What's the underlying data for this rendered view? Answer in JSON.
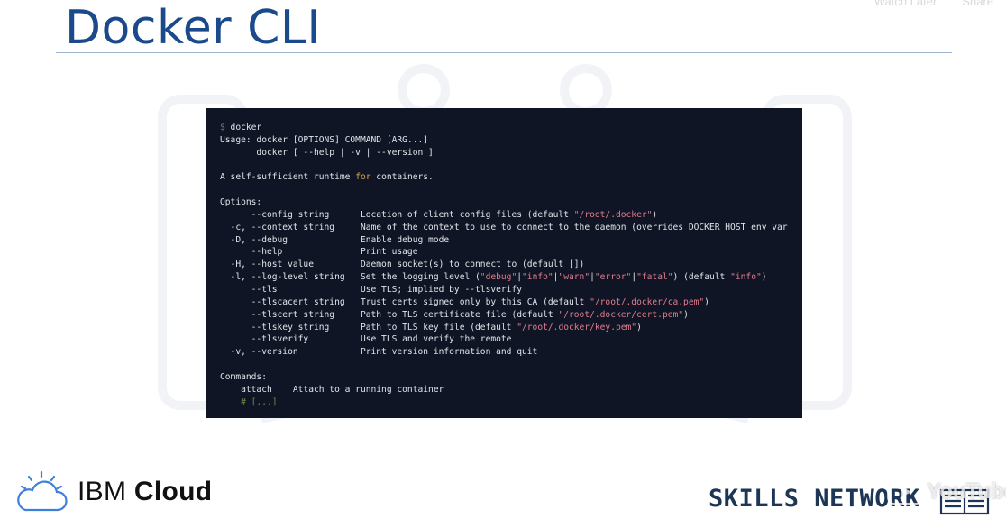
{
  "slide": {
    "title": "Docker CLI"
  },
  "youtube": {
    "watch_later_label": "Watch Later",
    "share_label": "Share",
    "logo_text": "YouTube"
  },
  "terminal": {
    "l01_prompt": "$",
    "l01_cmd": " docker",
    "l02": "Usage: docker [OPTIONS] COMMAND [ARG...]",
    "l03": "       docker [ --help | -v | --version ]",
    "l05a": "A self-sufficient runtime ",
    "l05kw": "for",
    "l05b": " containers.",
    "l07": "Options:",
    "l08a": "      --config string      Location of client config files (default ",
    "l08s": "\"/root/.docker\"",
    "l08b": ")",
    "l09": "  -c, --context string     Name of the context to use to connect to the daemon (overrides DOCKER_HOST env var",
    "l10": "  -D, --debug              Enable debug mode",
    "l11": "      --help               Print usage",
    "l12": "  -H, --host value         Daemon socket(s) to connect to (default [])",
    "l13a": "  -l, --log-level string   Set the logging level (",
    "l13s1": "\"debug\"",
    "l13p1": "|",
    "l13s2": "\"info\"",
    "l13p2": "|",
    "l13s3": "\"warn\"",
    "l13p3": "|",
    "l13s4": "\"error\"",
    "l13p4": "|",
    "l13s5": "\"fatal\"",
    "l13b": ") (default ",
    "l13s6": "\"info\"",
    "l13c": ")",
    "l14": "      --tls                Use TLS; implied by --tlsverify",
    "l15a": "      --tlscacert string   Trust certs signed only by this CA (default ",
    "l15s": "\"/root/.docker/ca.pem\"",
    "l15b": ")",
    "l16a": "      --tlscert string     Path to TLS certificate file (default ",
    "l16s": "\"/root/.docker/cert.pem\"",
    "l16b": ")",
    "l17a": "      --tlskey string      Path to TLS key file (default ",
    "l17s": "\"/root/.docker/key.pem\"",
    "l17b": ")",
    "l18": "      --tlsverify          Use TLS and verify the remote",
    "l19": "  -v, --version            Print version information and quit",
    "l21": "Commands:",
    "l22": "    attach    Attach to a running container",
    "l23_indent": "    ",
    "l23_comment": "# [...]"
  },
  "branding": {
    "ibm_prefix": "IBM ",
    "ibm_bold": "Cloud",
    "skills_network": "SKILLS NETWORK"
  },
  "colors": {
    "title": "#1a4a8c",
    "terminal_bg": "#0f1524",
    "string": "#e17c8e",
    "keyword": "#d6a552",
    "comment": "#6e8f48"
  }
}
